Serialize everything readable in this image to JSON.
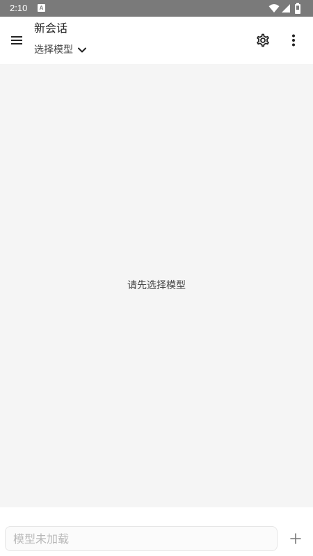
{
  "status_bar": {
    "time": "2:10",
    "notification_badge": "A",
    "icons": [
      "wifi-icon",
      "signal-icon",
      "battery-icon"
    ]
  },
  "app_bar": {
    "title": "新会话",
    "model_select_label": "选择模型",
    "icons": [
      "menu-icon",
      "chevron-down-icon",
      "gear-icon",
      "more-vert-icon"
    ]
  },
  "main": {
    "empty_message": "请先选择模型"
  },
  "input_bar": {
    "placeholder": "模型未加载",
    "value": "",
    "add_icon": "plus-icon"
  },
  "colors": {
    "status_bar_bg": "#7a7a7a",
    "main_bg": "#f5f5f5",
    "surface": "#ffffff"
  }
}
